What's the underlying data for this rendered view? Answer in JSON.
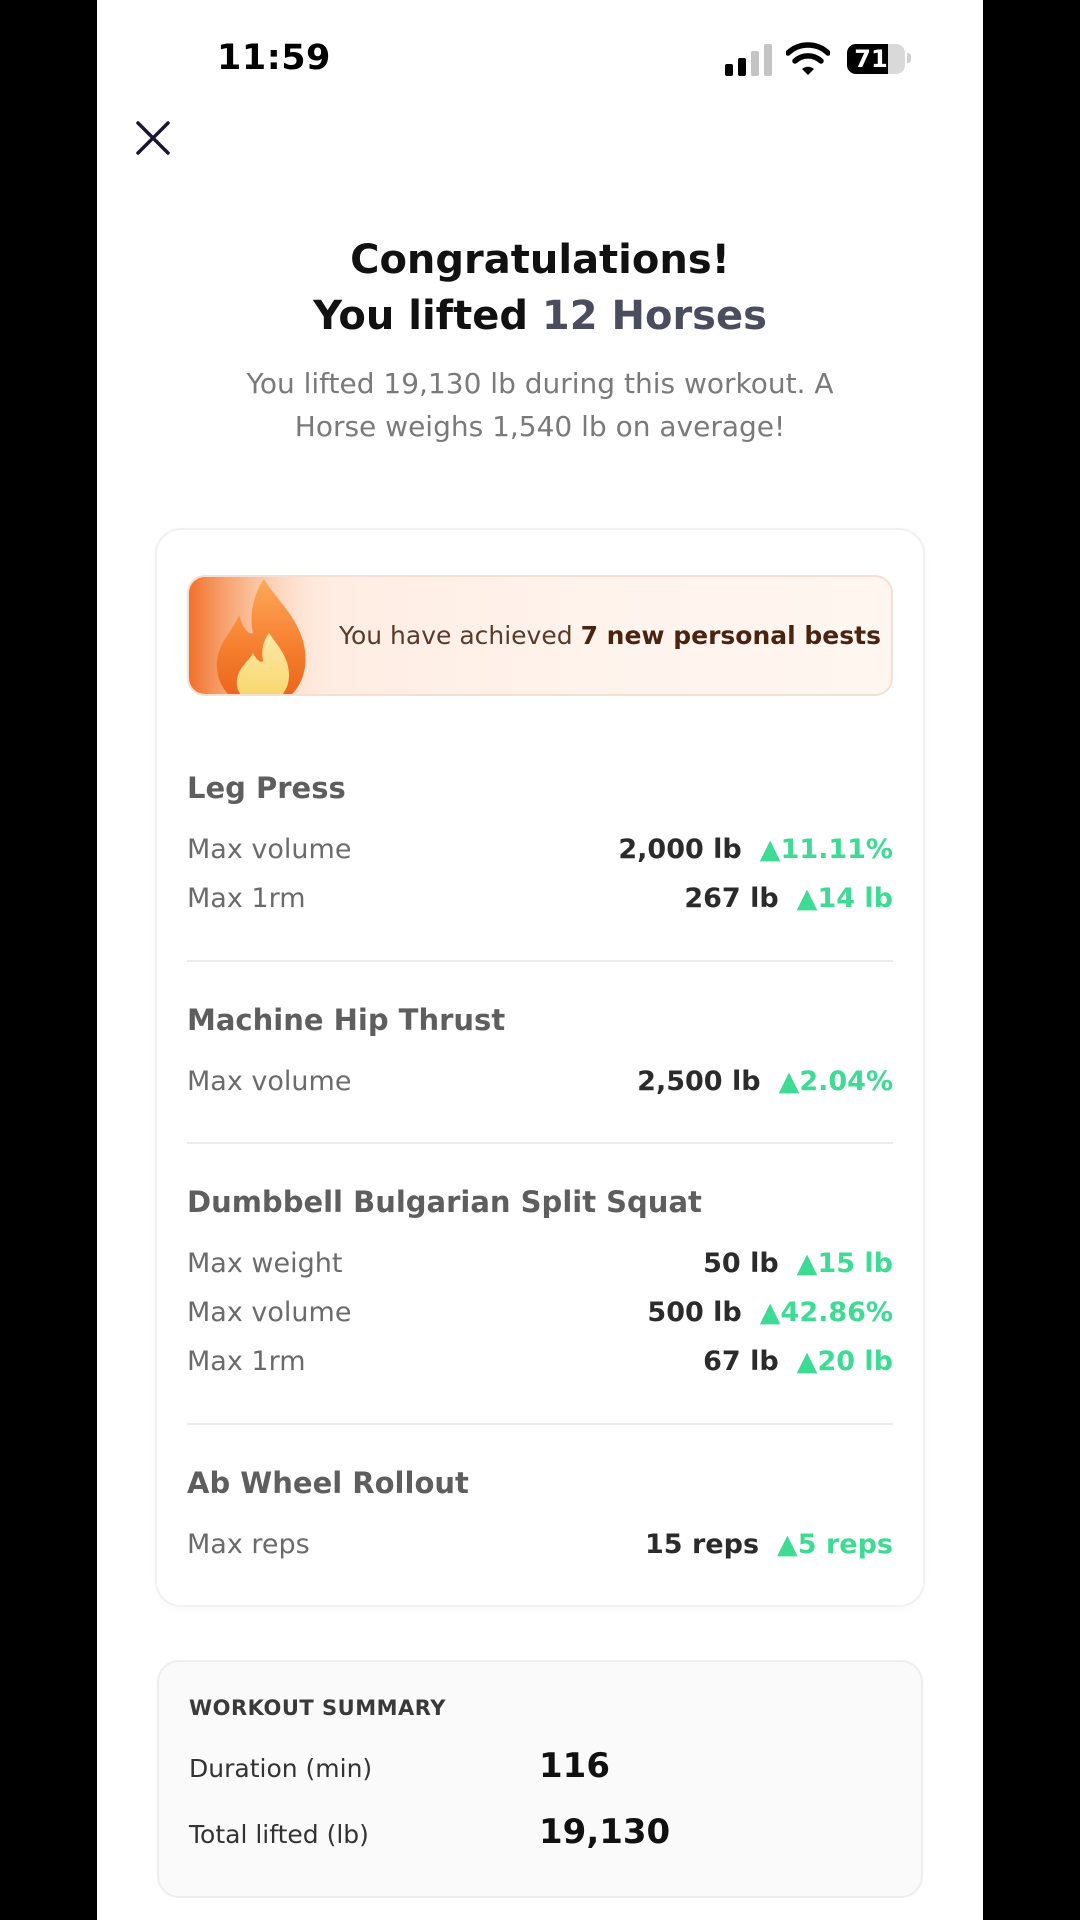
{
  "status_bar": {
    "time": "11:59",
    "battery": "71",
    "battery_level": 0.71
  },
  "header": {
    "title_line1": "Congratulations!",
    "title_prefix": "You lifted ",
    "title_highlight": "12 Horses",
    "subtitle": "You lifted 19,130 lb during this workout. A Horse weighs 1,540 lb on average!"
  },
  "personal_bests": {
    "banner_prefix": "You have achieved ",
    "banner_bold": "7 new personal bests",
    "exercises": [
      {
        "name": "Leg Press",
        "rows": [
          {
            "label": "Max volume",
            "value": "2,000 lb",
            "delta": "11.11%"
          },
          {
            "label": "Max 1rm",
            "value": "267 lb",
            "delta": "14 lb"
          }
        ]
      },
      {
        "name": "Machine Hip Thrust",
        "rows": [
          {
            "label": "Max volume",
            "value": "2,500 lb",
            "delta": "2.04%"
          }
        ]
      },
      {
        "name": "Dumbbell Bulgarian Split Squat",
        "rows": [
          {
            "label": "Max weight",
            "value": "50 lb",
            "delta": "15 lb"
          },
          {
            "label": "Max volume",
            "value": "500 lb",
            "delta": "42.86%"
          },
          {
            "label": "Max 1rm",
            "value": "67 lb",
            "delta": "20 lb"
          }
        ]
      },
      {
        "name": "Ab Wheel Rollout",
        "rows": [
          {
            "label": "Max reps",
            "value": "15 reps",
            "delta": "5 reps"
          }
        ]
      }
    ],
    "delta_color": "#3ddb93"
  },
  "summary": {
    "title": "WORKOUT SUMMARY",
    "rows": [
      {
        "label": "Duration (min)",
        "value": "116"
      },
      {
        "label": "Total lifted (lb)",
        "value": "19,130"
      }
    ]
  }
}
